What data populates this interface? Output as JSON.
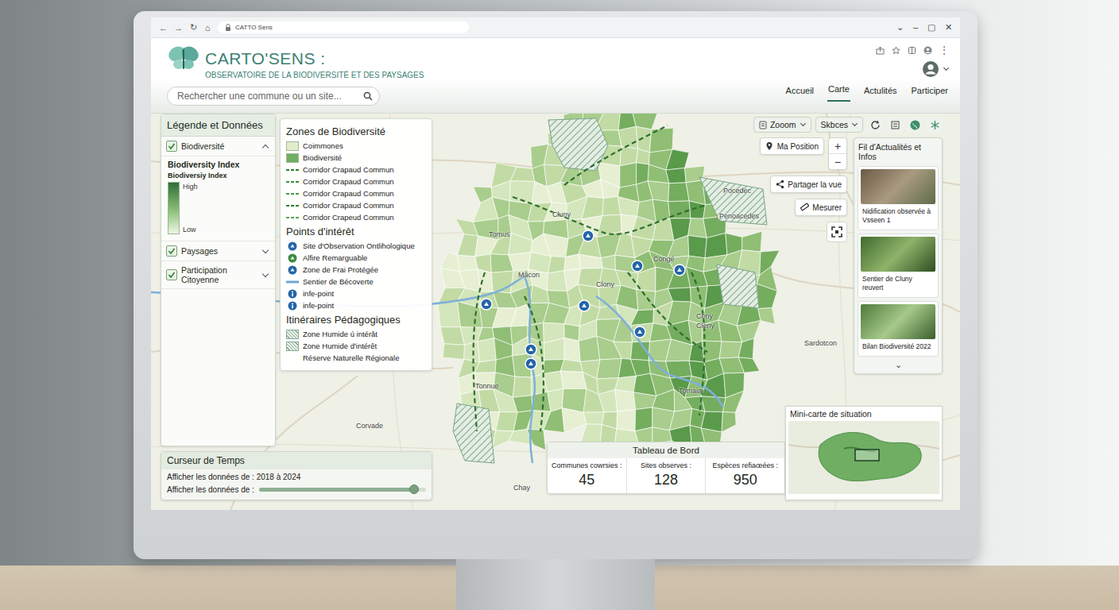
{
  "browser": {
    "tab_title": "CATTO Sens",
    "nav": [
      "←",
      "→",
      "↻",
      "⌂"
    ],
    "controls": [
      "⌄",
      "–",
      "▢",
      "✕"
    ],
    "menu": "⋮"
  },
  "header": {
    "title": "CARTO'SENS :",
    "subtitle": "OBSERVATOIRE DE LA BIODIVERSITÉ ET DES PAYSAGES",
    "search": {
      "placeholder": "Rechercher une commune ou un site..."
    },
    "nav": [
      {
        "label": "Accueil",
        "selected": false
      },
      {
        "label": "Carte",
        "selected": true
      },
      {
        "label": "Actulités",
        "selected": false
      },
      {
        "label": "Participer",
        "selected": false
      }
    ]
  },
  "toolbar": {
    "dropdowns": [
      "Zooom",
      "Skbces"
    ]
  },
  "layers": {
    "title": "Légende et Données",
    "sections": [
      {
        "label": "Biodiversité",
        "checked": true,
        "expanded": true
      },
      {
        "label": "Paysages",
        "checked": true,
        "expanded": false
      },
      {
        "label": "Participation Citoyenne",
        "checked": true,
        "expanded": false
      }
    ],
    "index": {
      "title": "Biodiversity Index",
      "subtitle": "Biodiversiy Index",
      "high": "High",
      "low": "Low"
    }
  },
  "legend": {
    "groups": [
      {
        "title": "Zones de Biodiversité",
        "items": [
          {
            "label": "Coimmones",
            "kind": "swatch",
            "color": "#e3edc9"
          },
          {
            "label": "Biodiversité",
            "kind": "swatch",
            "color": "#6fae63"
          },
          {
            "label": "Corridor Crapaud Commun",
            "kind": "corridor",
            "color": "#2f7d32"
          },
          {
            "label": "Corridor Crapaud Commun",
            "kind": "corridor",
            "color": "#3d8b3d"
          },
          {
            "label": "Corridor Crapaud Commun",
            "kind": "corridor",
            "color": "#4a9a45"
          },
          {
            "label": "Corridor Crapaud Commun",
            "kind": "corridor",
            "color": "#2f7d32"
          },
          {
            "label": "Corridor Crapeud Commun",
            "kind": "corridor",
            "color": "#5aa552"
          }
        ]
      },
      {
        "title": "Points d'intérêt",
        "items": [
          {
            "label": "Site d'Observation Ontlihologique",
            "kind": "poi",
            "color": "#2565a8"
          },
          {
            "label": "Alfire Remarguable",
            "kind": "poi",
            "color": "#3b8c3f"
          },
          {
            "label": "Zone de Frai Protégée",
            "kind": "poi",
            "color": "#2565a8"
          },
          {
            "label": "Sentier de Bécoverte",
            "kind": "trail",
            "color": "#6ea6d2"
          },
          {
            "label": "infe-point",
            "kind": "info",
            "color": "#2565a8"
          },
          {
            "label": "infe-point",
            "kind": "info",
            "color": "#2565a8"
          }
        ]
      },
      {
        "title": "Itinéraires Pédagogiques",
        "items": [
          {
            "label": "Zone Humide ú intérât",
            "kind": "hatch",
            "color": "#8aa99a"
          },
          {
            "label": "Zone Humide d'intérêt",
            "kind": "hatch",
            "color": "#8aa99a"
          },
          {
            "label": "Réserve Naturelle Régionale",
            "kind": "plain"
          }
        ]
      }
    ]
  },
  "map": {
    "labels": [
      "Tomus",
      "Cluny",
      "Mâcon",
      "Clony",
      "Congé",
      "Ceny",
      "Cleny",
      "Tonnue",
      "Tomaia",
      "Sardotcon",
      "Pocedec",
      "Penoacedes",
      "Corvade",
      "Chay"
    ]
  },
  "map_controls": {
    "zoom_in": "+",
    "zoom_out": "−",
    "buttons": [
      "Ma Position",
      "Partager la vue",
      "Mesurer"
    ]
  },
  "news": {
    "title": "Fil d'Actualités et Infos",
    "items": [
      "Nidification observée à Vsseen 1",
      "Sentier de Cluny reuvert",
      "Bilan Biodiversité 2022"
    ],
    "more": "⌄"
  },
  "time": {
    "title": "Curseur de Temps",
    "range": "Afficher les données de : 2018 à 2024",
    "label": "Afficher les données de :",
    "level": 0.93
  },
  "dashboard": {
    "title": "Tableau de Bord",
    "stats": [
      {
        "label": "Communes cowrsies :",
        "value": "45"
      },
      {
        "label": "Sites observes :",
        "value": "128"
      },
      {
        "label": "Espèces refiaœées :",
        "value": "950"
      }
    ]
  },
  "minimap": {
    "title": "Mini-carte de situation"
  }
}
